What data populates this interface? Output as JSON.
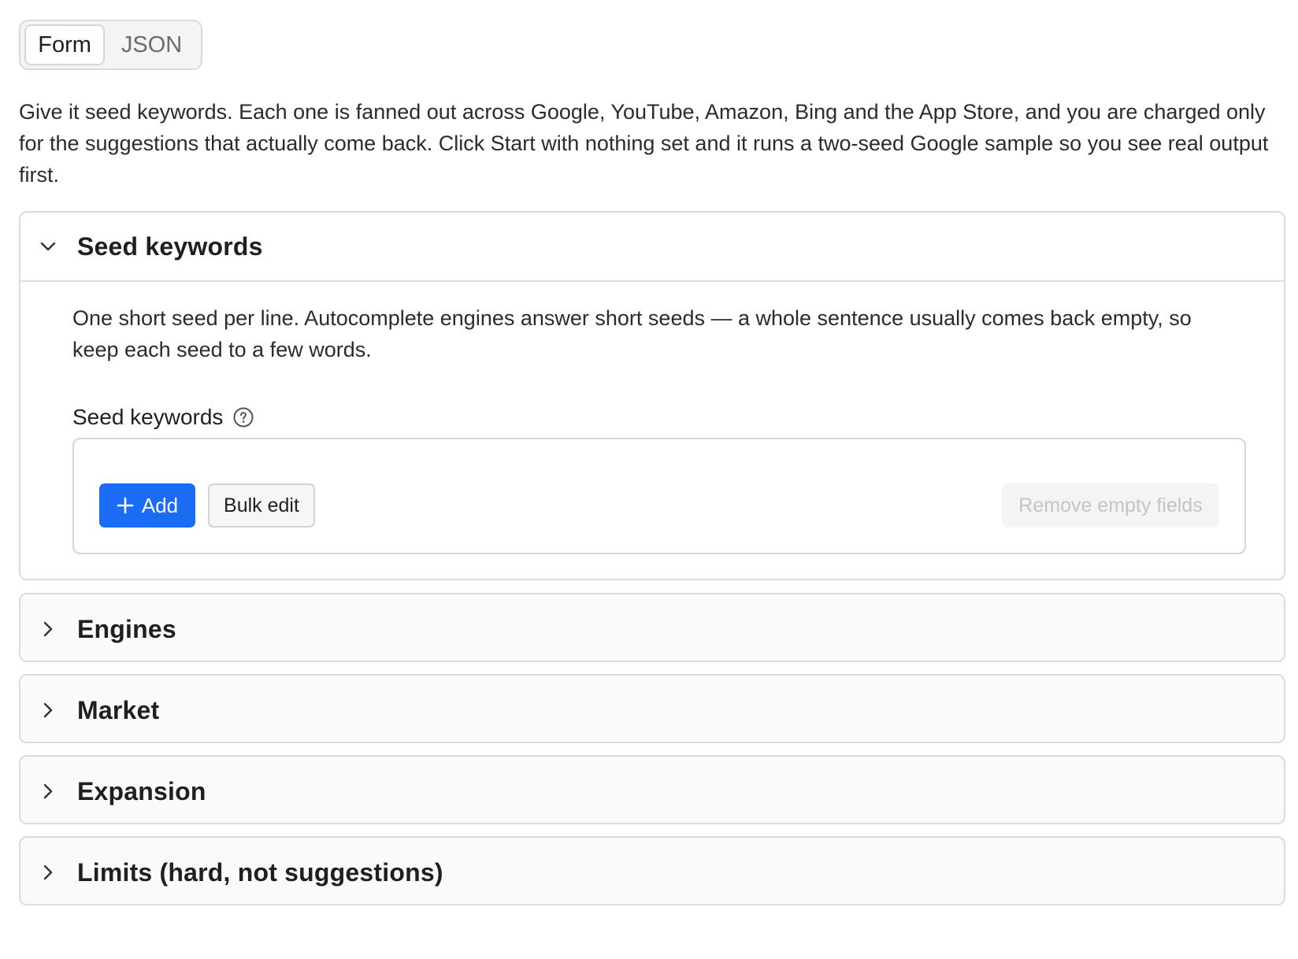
{
  "view_toggle": {
    "options": [
      "Form",
      "JSON"
    ],
    "selected": "Form"
  },
  "intro_text": "Give it seed keywords. Each one is fanned out across Google, YouTube, Amazon, Bing and the App Store, and you are charged only for the suggestions that actually come back. Click Start with nothing set and it runs a two-seed Google sample so you see real output first.",
  "sections": [
    {
      "title": "Seed keywords",
      "expanded": true,
      "description": "One short seed per line. Autocomplete engines answer short seeds — a whole sentence usually comes back empty, so keep each seed to a few words.",
      "field_label": "Seed keywords",
      "buttons": {
        "add": "Add",
        "bulk_edit": "Bulk edit",
        "remove_empty": "Remove empty fields"
      }
    },
    {
      "title": "Engines",
      "expanded": false
    },
    {
      "title": "Market",
      "expanded": false
    },
    {
      "title": "Expansion",
      "expanded": false
    },
    {
      "title": "Limits (hard, not suggestions)",
      "expanded": false
    }
  ],
  "colors": {
    "primary": "#1a6cf5",
    "border": "#dcdcdc",
    "collapsed_bg": "#fafafa",
    "disabled_text": "#c4c4c4"
  },
  "icons": {
    "expanded": "chevron-down-icon",
    "collapsed": "chevron-right-icon",
    "help": "question-circle-icon",
    "add": "plus-icon"
  }
}
